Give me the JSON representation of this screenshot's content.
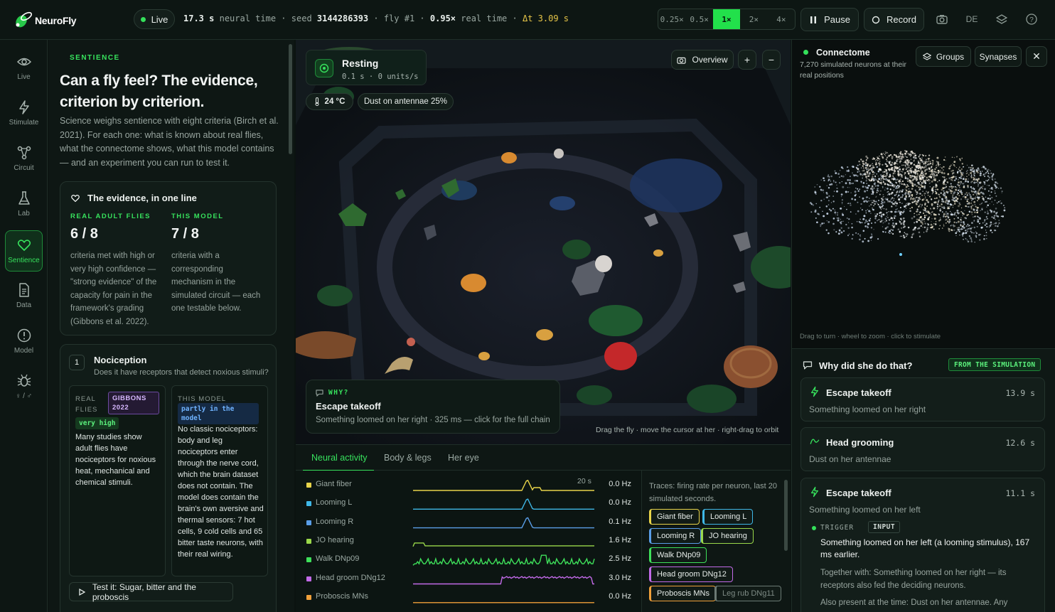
{
  "app": {
    "name": "NeuroFly"
  },
  "topbar": {
    "live": "Live",
    "neural_time_value": "17.3 s",
    "neural_time_label": "neural time",
    "seed_label": "seed",
    "seed_value": "3144286393",
    "fly_label": "fly #1",
    "real_time_value": "0.95×",
    "real_time_label": "real time",
    "dt": "Δt 3.09 s",
    "speeds": [
      "0.25×",
      "0.5×",
      "1×",
      "2×",
      "4×"
    ],
    "speed_selected": "1×",
    "pause": "Pause",
    "record": "Record",
    "lang": "DE",
    "icons": [
      "camera-icon",
      "layers-icon",
      "help-icon"
    ]
  },
  "nav": [
    {
      "label": "Live",
      "icon": "eye-icon"
    },
    {
      "label": "Stimulate",
      "icon": "lightning-icon"
    },
    {
      "label": "Circuit",
      "icon": "circuit-icon"
    },
    {
      "label": "Lab",
      "icon": "flask-icon"
    },
    {
      "label": "Sentience",
      "icon": "heart-icon",
      "active": true
    },
    {
      "label": "Data",
      "icon": "document-icon"
    },
    {
      "label": "Model",
      "icon": "info-icon"
    },
    {
      "label": "♀ / ♂",
      "icon": "bug-icon"
    }
  ],
  "sentience": {
    "eyebrow": "SENTIENCE",
    "title": "Can a fly feel? The evidence, criterion by criterion.",
    "intro": "Science weighs sentience with eight criteria (Birch et al. 2021). For each one: what is known about real flies, what the connectome shows, what this model contains — and an experiment you can run to test it.",
    "evidence": {
      "heading": "The evidence, in one line",
      "real": {
        "label": "REAL ADULT FLIES",
        "score": "6 / 8",
        "desc": "criteria met with high or very high confidence — \"strong evidence\" of the capacity for pain in the framework's grading (Gibbons et al. 2022)."
      },
      "model": {
        "label": "THIS MODEL",
        "score": "7 / 8",
        "desc": "criteria with a corresponding mechanism in the simulated circuit — each one testable below."
      }
    },
    "criterion": {
      "number": "1",
      "title": "Nociception",
      "question": "Does it have receptors that detect noxious stimuli?",
      "real_label": "REAL FLIES",
      "real_badge": "GIBBONS 2022",
      "real_level": "very high",
      "real_text": "Many studies show adult flies have nociceptors for noxious heat, mechanical and chemical stimuli.",
      "model_label": "THIS MODEL",
      "model_badge": "partly in the model",
      "model_text": "No classic nociceptors: body and leg nociceptors enter through the nerve cord, which the brain dataset does not contain. The model does contain the brain's own aversive and thermal sensors: 7 hot cells, 9 cold cells and 65 bitter taste neurons, with their real wiring.",
      "test": "Test it: Sugar, bitter and the proboscis"
    }
  },
  "scene": {
    "state": "Resting",
    "state_sub": "0.1 s · 0 units/s",
    "temp": "24 °C",
    "dust": "Dust on antennae 25%",
    "overview": "Overview",
    "plus": "+",
    "minus": "−",
    "why_label": "WHY?",
    "why_title": "Escape takeoff",
    "why_text": "Something loomed on her right · 325 ms — click for the full chain",
    "hint": "Drag the fly · move the cursor at her · right-drag to orbit"
  },
  "tabs": [
    "Neural activity",
    "Body & legs",
    "Her eye"
  ],
  "neural": {
    "window": "20 s",
    "traces": [
      {
        "name": "Giant fiber",
        "rate": "0.0 Hz",
        "color": "#e8d44a"
      },
      {
        "name": "Looming L",
        "rate": "0.0 Hz",
        "color": "#3fb8e8"
      },
      {
        "name": "Looming R",
        "rate": "0.1 Hz",
        "color": "#5a9ee8"
      },
      {
        "name": "JO hearing",
        "rate": "1.6 Hz",
        "color": "#9ad84a"
      },
      {
        "name": "Walk DNp09",
        "rate": "2.5 Hz",
        "color": "#3ee05a"
      },
      {
        "name": "Head groom DNg12",
        "rate": "3.0 Hz",
        "color": "#c26ae8"
      },
      {
        "name": "Proboscis MNs",
        "rate": "0.0 Hz",
        "color": "#f0a03a"
      }
    ],
    "legend_text": "Traces: firing rate per neuron, last 20 simulated seconds.",
    "chips": [
      {
        "label": "Giant fiber",
        "color": "#e8d44a"
      },
      {
        "label": "Looming L",
        "color": "#3fb8e8"
      },
      {
        "label": "Looming R",
        "color": "#5a9ee8"
      },
      {
        "label": "JO hearing",
        "color": "#9ad84a"
      },
      {
        "label": "Walk DNp09",
        "color": "#3ee05a"
      },
      {
        "label": "Head groom DNg12",
        "color": "#c26ae8"
      },
      {
        "label": "Proboscis MNs",
        "color": "#f0a03a"
      },
      {
        "label": "Leg rub DNg11",
        "color": "#6b7a74"
      }
    ]
  },
  "connectome": {
    "title": "Connectome",
    "sub": "7,270 simulated neurons at their real positions",
    "groups": "Groups",
    "synapses": "Synapses",
    "hint": "Drag to turn · wheel to zoom · click to stimulate"
  },
  "why": {
    "title": "Why did she do that?",
    "badge": "FROM THE SIMULATION",
    "events": [
      {
        "title": "Escape takeoff",
        "time": "13.9 s",
        "sub": "Something loomed on her right",
        "icon": "lightning-icon"
      },
      {
        "title": "Head grooming",
        "time": "12.6 s",
        "sub": "Dust on her antennae",
        "icon": "wave-icon"
      },
      {
        "title": "Escape takeoff",
        "time": "11.1 s",
        "sub": "Something loomed on her left",
        "icon": "lightning-icon"
      }
    ],
    "trigger_label": "TRIGGER",
    "input_badge": "INPUT",
    "trigger_text": "Something loomed on her left (a looming stimulus), 167 ms earlier.",
    "together": "Together with: Something loomed on her right — its receptors also fed the deciding neurons.",
    "also": "Also present at the time: Dust on her antennae. Any"
  }
}
